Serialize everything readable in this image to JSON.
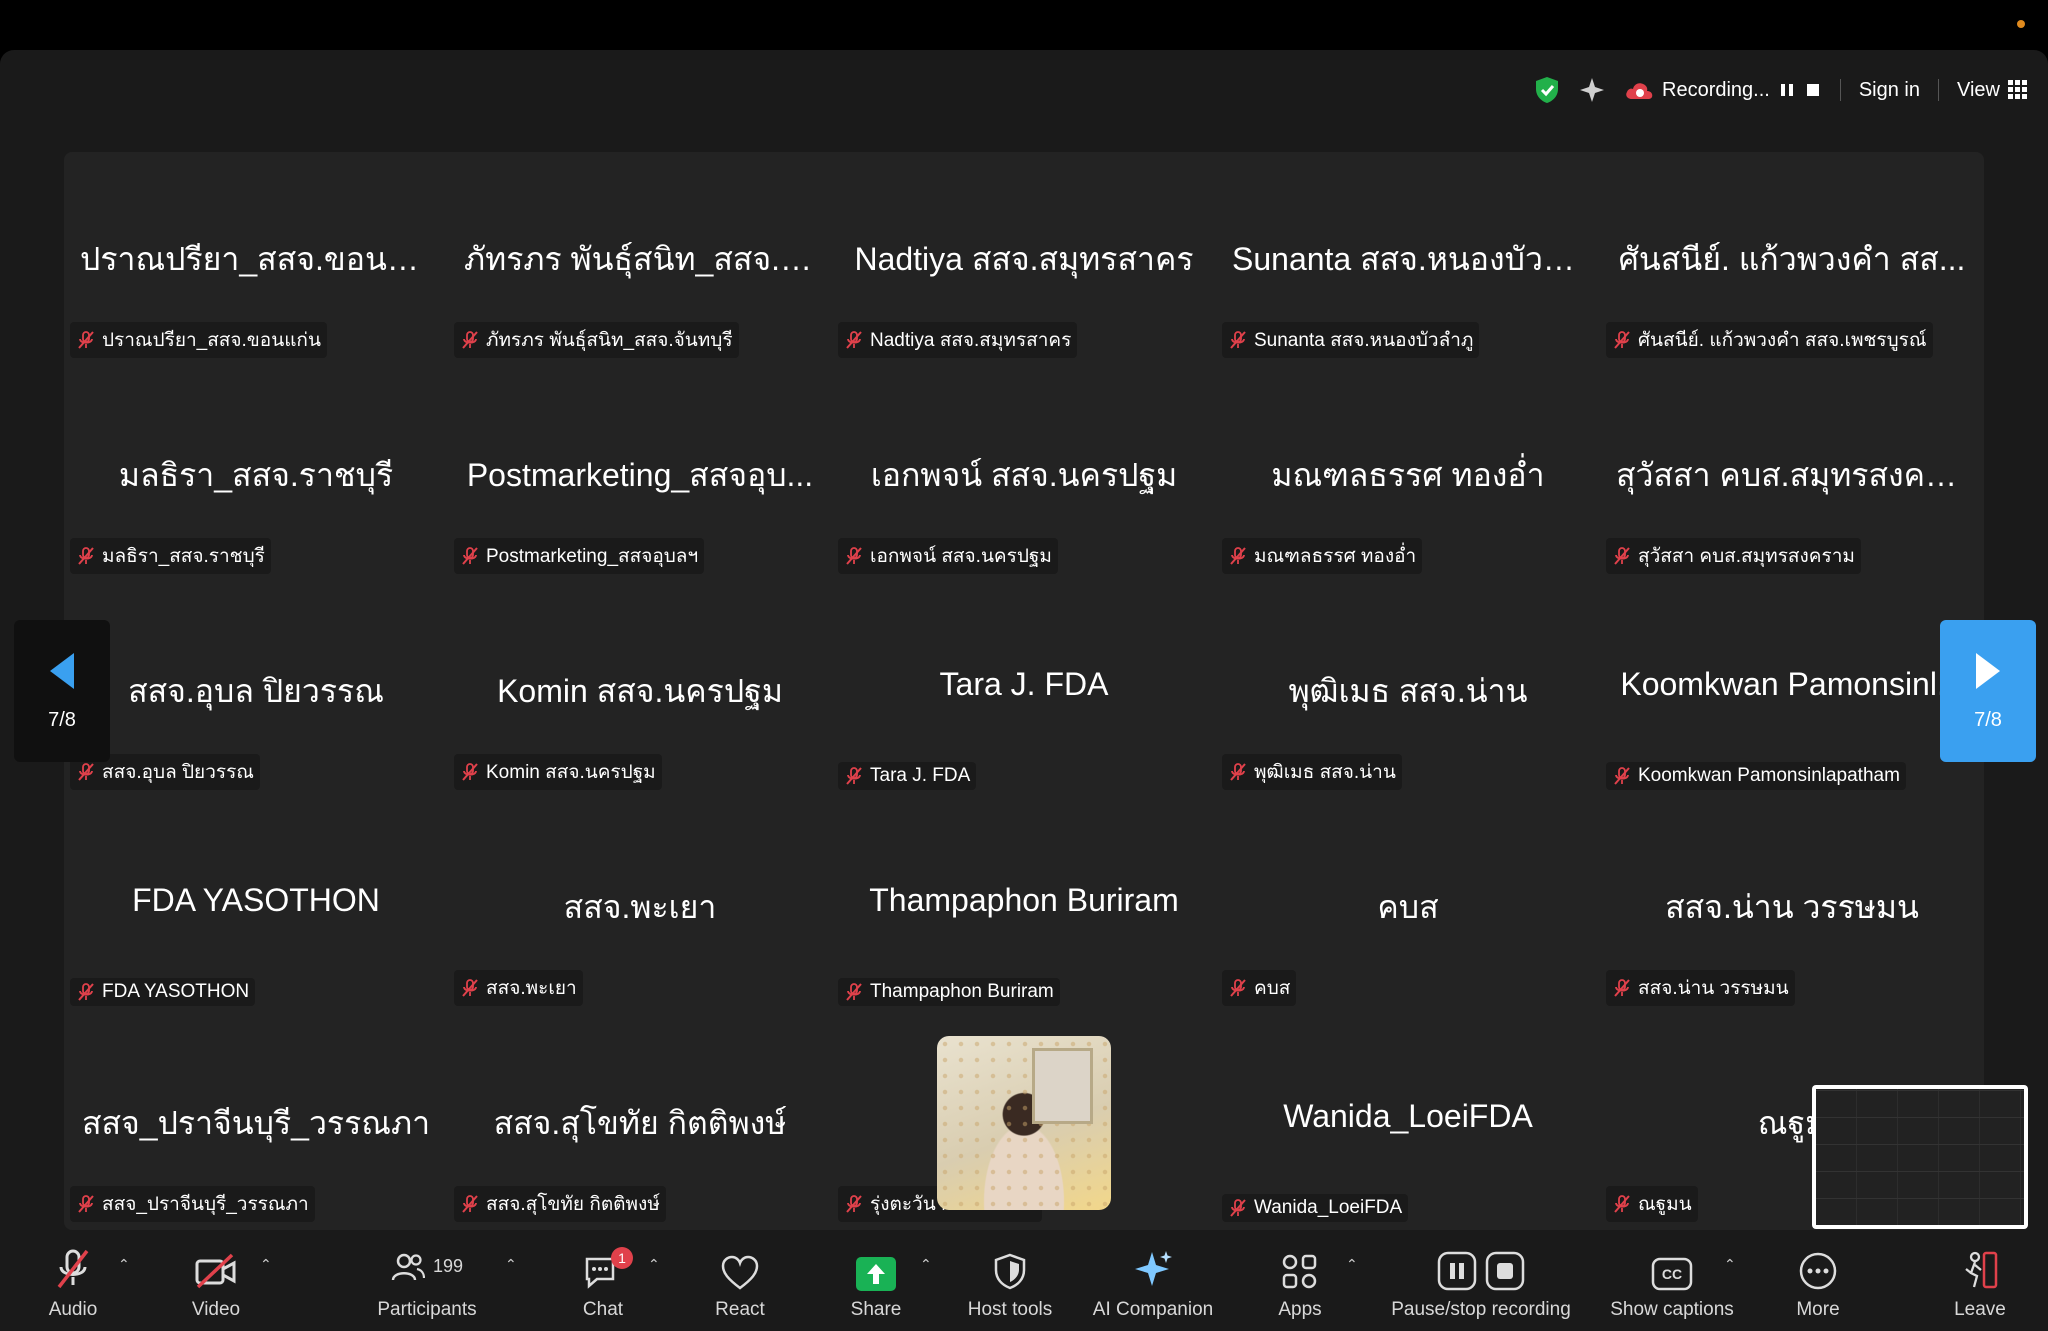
{
  "topbar": {
    "recording_label": "Recording...",
    "signin_label": "Sign in",
    "view_label": "View"
  },
  "pagination": {
    "left": "7/8",
    "right": "7/8"
  },
  "tiles": [
    {
      "big": "ปราณปรียา_สสจ.ขอนแ...",
      "label": "ปราณปรียา_สสจ.ขอนแก่น"
    },
    {
      "big": "ภัทรภร พันธุ์สนิท_สสจ.จั...",
      "label": "ภัทรภร พันธุ์สนิท_สสจ.จันทบุรี"
    },
    {
      "big": "Nadtiya สสจ.สมุทรสาคร",
      "label": "Nadtiya สสจ.สมุทรสาคร"
    },
    {
      "big": "Sunanta สสจ.หนองบัวล...",
      "label": "Sunanta สสจ.หนองบัวลำภู"
    },
    {
      "big": "ศันสนีย์. แก้วพวงคำ สส...",
      "label": "ศันสนีย์. แก้วพวงคำ สสจ.เพชรบูรณ์"
    },
    {
      "big": "มลธิรา_สสจ.ราชบุรี",
      "label": "มลธิรา_สสจ.ราชบุรี"
    },
    {
      "big": "Postmarketing_สสจอุบ...",
      "label": "Postmarketing_สสจอุบลฯ"
    },
    {
      "big": "เอกพจน์ สสจ.นครปฐม",
      "label": "เอกพจน์ สสจ.นครปฐม"
    },
    {
      "big": "มณฑลธรรศ ทองอ่ำ",
      "label": "มณฑลธรรศ ทองอ่ำ"
    },
    {
      "big": "สุวัสสา คบส.สมุทรสงคร...",
      "label": "สุวัสสา คบส.สมุทรสงคราม"
    },
    {
      "big": "สสจ.อุบล ปิยวรรณ",
      "label": "สสจ.อุบล ปิยวรรณ"
    },
    {
      "big": "Komin สสจ.นครปฐม",
      "label": "Komin สสจ.นครปฐม"
    },
    {
      "big": "Tara J. FDA",
      "label": "Tara J. FDA"
    },
    {
      "big": "พุฒิเมธ สสจ.น่าน",
      "label": "พุฒิเมธ สสจ.น่าน"
    },
    {
      "big": "Koomkwan Pamonsinl...",
      "label": "Koomkwan Pamonsinlapatham"
    },
    {
      "big": "FDA YASOTHON",
      "label": "FDA YASOTHON"
    },
    {
      "big": "สสจ.พะเยา",
      "label": "สสจ.พะเยา"
    },
    {
      "big": "Thampaphon Buriram",
      "label": "Thampaphon Buriram"
    },
    {
      "big": "คบส",
      "label": "คบส"
    },
    {
      "big": "สสจ.น่าน วรรษมน",
      "label": "สสจ.น่าน วรรษมน"
    },
    {
      "big": "สสจ_ปราจีนบุรี_วรรณภา",
      "label": "สสจ_ปราจีนบุรี_วรรณภา"
    },
    {
      "big": "สสจ.สุโขทัย กิตติพงษ์",
      "label": "สสจ.สุโขทัย กิตติพงษ์"
    },
    {
      "big": "",
      "label": "รุ่งตะวัน กอง คบ.อย."
    },
    {
      "big": "Wanida_LoeiFDA",
      "label": "Wanida_LoeiFDA"
    },
    {
      "big": "ณฐูม",
      "label": "ณฐูมน"
    }
  ],
  "toolbar": {
    "audio": "Audio",
    "video": "Video",
    "participants": "Participants",
    "participants_count": "199",
    "chat": "Chat",
    "chat_badge": "1",
    "react": "React",
    "share": "Share",
    "host_tools": "Host tools",
    "ai_companion": "AI Companion",
    "apps": "Apps",
    "pause_stop": "Pause/stop recording",
    "captions": "Show captions",
    "more": "More",
    "leave": "Leave"
  },
  "colors": {
    "accent": "#3aa0f0",
    "share_green": "#19b255",
    "leave_red": "#e0414b",
    "muted_red": "#e0414b"
  }
}
